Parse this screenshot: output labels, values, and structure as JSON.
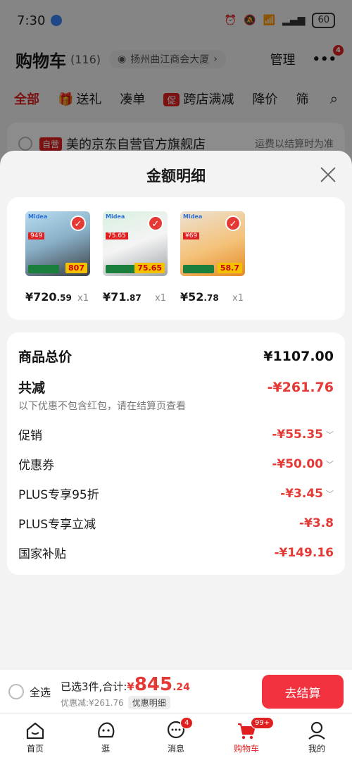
{
  "status_bar": {
    "time": "7:30",
    "battery": "60"
  },
  "background": {
    "title": "购物车",
    "count": "(116)",
    "location": "扬州曲江商会大厦",
    "manage": "管理",
    "more_badge": "4",
    "tabs": [
      "全部",
      "送礼",
      "凑单",
      "跨店满减",
      "降价",
      "筛"
    ],
    "promo_tag": "促",
    "store_badge": "自营",
    "store_name": "美的京东自营官方旗舰店",
    "store_ship": "运费以结算时为准"
  },
  "sheet": {
    "title": "金额明细",
    "products": [
      {
        "price_int": "¥720",
        "price_dec": ".59",
        "qty": "x1",
        "brand": "Midea",
        "promo": "807",
        "tag": "949"
      },
      {
        "price_int": "¥71",
        "price_dec": ".87",
        "qty": "x1",
        "brand": "Midea",
        "promo": "75.65",
        "tag": "75.65"
      },
      {
        "price_int": "¥52",
        "price_dec": ".78",
        "qty": "x1",
        "brand": "Midea",
        "promo": "58.7",
        "tag": "¥69"
      }
    ],
    "total_label": "商品总价",
    "total_value": "¥1107.00",
    "discount_label": "共减",
    "discount_value": "-¥261.76",
    "discount_note": "以下优惠不包含红包，请在结算页查看",
    "items": [
      {
        "label": "促销",
        "value": "-¥55.35",
        "expandable": true
      },
      {
        "label": "优惠券",
        "value": "-¥50.00",
        "expandable": true
      },
      {
        "label": "PLUS专享95折",
        "value": "-¥3.45",
        "expandable": true
      },
      {
        "label": "PLUS专享立减",
        "value": "-¥3.8",
        "expandable": false
      },
      {
        "label": "国家补贴",
        "value": "-¥149.16",
        "expandable": false
      }
    ]
  },
  "checkout": {
    "select_all": "全选",
    "selected_text": "已选3件,合计:",
    "yen": "¥",
    "total_int": "845",
    "total_dec": ".24",
    "discount_text": "优惠减:¥261.76",
    "detail_label": "优惠明细",
    "button": "去结算"
  },
  "tabbar": {
    "items": [
      {
        "label": "首页",
        "icon": "home-icon"
      },
      {
        "label": "逛",
        "icon": "face-icon"
      },
      {
        "label": "消息",
        "icon": "message-icon",
        "badge": "4"
      },
      {
        "label": "购物车",
        "icon": "cart-icon",
        "badge": "99+"
      },
      {
        "label": "我的",
        "icon": "profile-icon"
      }
    ]
  },
  "colors": {
    "accent": "#e53935",
    "button": "#f2323f"
  }
}
